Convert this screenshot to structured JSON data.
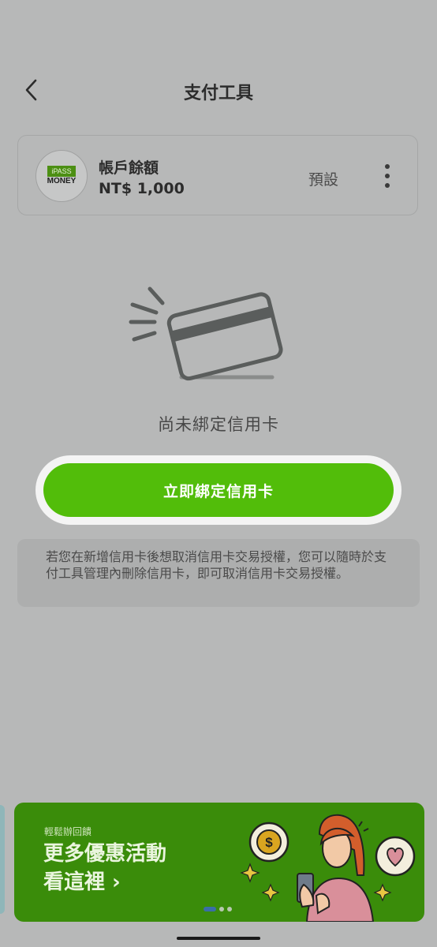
{
  "header": {
    "title": "支付工具",
    "back_icon": "chevron-left-icon"
  },
  "wallet": {
    "logo_top": "iPASS",
    "logo_bottom": "MONEY",
    "name": "帳戶餘額",
    "balance": "NT$ 1,000",
    "default_label": "預設",
    "more_icon": "more-vertical-icon"
  },
  "empty_state": {
    "illustration": "credit-card-icon",
    "text": "尚未綁定信用卡"
  },
  "bind_button": {
    "label": "立即綁定信用卡"
  },
  "notice": {
    "text": "若您在新增信用卡後想取消信用卡交易授權，您可以隨時於支付工具管理內刪除信用卡，即可取消信用卡交易授權。"
  },
  "banner": {
    "subtitle": "輕鬆辦回饋",
    "title_line1": "更多優惠活動",
    "title_line2": "看這裡 ›",
    "carousel_total": 3,
    "carousel_active": 1
  },
  "colors": {
    "overlay_background": "#b7b8b8",
    "primary_green": "#52bd0a",
    "banner_green": "#3a8c0a"
  }
}
